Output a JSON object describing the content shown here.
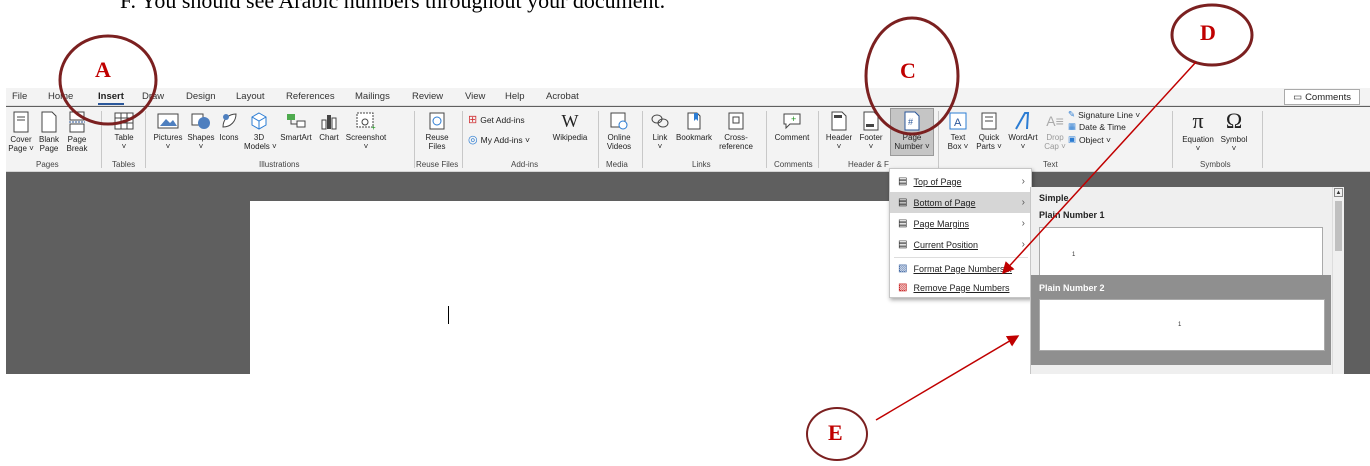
{
  "instruction": "F.   You should see Arabic numbers throughout your document.",
  "tabs": [
    "File",
    "Home",
    "Insert",
    "Draw",
    "Design",
    "Layout",
    "References",
    "Mailings",
    "Review",
    "View",
    "Help",
    "Acrobat"
  ],
  "active_tab": "Insert",
  "comments_label": "Comments",
  "ribbon": {
    "cover_page": "Cover\nPage ˅",
    "blank_page": "Blank\nPage",
    "page_break": "Page\nBreak",
    "table": "Table\n˅",
    "pictures": "Pictures\n˅",
    "shapes": "Shapes\n˅",
    "icons": "Icons",
    "models3d": "3D\nModels ˅",
    "smartart": "SmartArt",
    "chart": "Chart",
    "screenshot": "Screenshot\n˅",
    "reuse_files": "Reuse\nFiles",
    "get_addins": "Get Add-ins",
    "my_addins": "My Add-ins  ˅",
    "wikipedia": "Wikipedia",
    "online_videos": "Online\nVideos",
    "link": "Link\n˅",
    "bookmark": "Bookmark",
    "cross_reference": "Cross-\nreference",
    "comment": "Comment",
    "header": "Header\n˅",
    "footer": "Footer\n˅",
    "page_number": "Page\nNumber ˅",
    "text_box": "Text\nBox ˅",
    "quick_parts": "Quick\nParts ˅",
    "wordart": "WordArt\n˅",
    "drop_cap": "Drop\nCap ˅",
    "signature_line": "Signature Line  ˅",
    "date_time": "Date & Time",
    "object": "Object  ˅",
    "equation": "Equation\n˅",
    "symbol": "Symbol\n˅"
  },
  "groups": {
    "pages": "Pages",
    "tables": "Tables",
    "illustrations": "Illustrations",
    "reuse_files": "Reuse Files",
    "addins": "Add-ins",
    "media": "Media",
    "links": "Links",
    "comments": "Comments",
    "header_footer": "Header & F",
    "text": "Text",
    "symbols": "Symbols"
  },
  "menu": {
    "items": [
      {
        "label": "Top of Page",
        "has_submenu": true
      },
      {
        "label": "Bottom of Page",
        "has_submenu": true
      },
      {
        "label": "Page Margins",
        "has_submenu": true
      },
      {
        "label": "Current Position",
        "has_submenu": true
      },
      {
        "label": "Format Page Numbers...",
        "has_submenu": false
      },
      {
        "label": "Remove Page Numbers",
        "has_submenu": false
      }
    ],
    "highlighted": "Bottom of Page"
  },
  "gallery": {
    "section": "Simple",
    "item1_title": "Plain Number 1",
    "item2_title": "Plain Number 2",
    "item1_number": "1",
    "item2_number": "1"
  },
  "annotations": {
    "a": "A",
    "c": "C",
    "d": "D",
    "e": "E",
    "circle_color": "#7b2020",
    "letter_color": "#c00000",
    "arrow_color": "#c00000"
  }
}
